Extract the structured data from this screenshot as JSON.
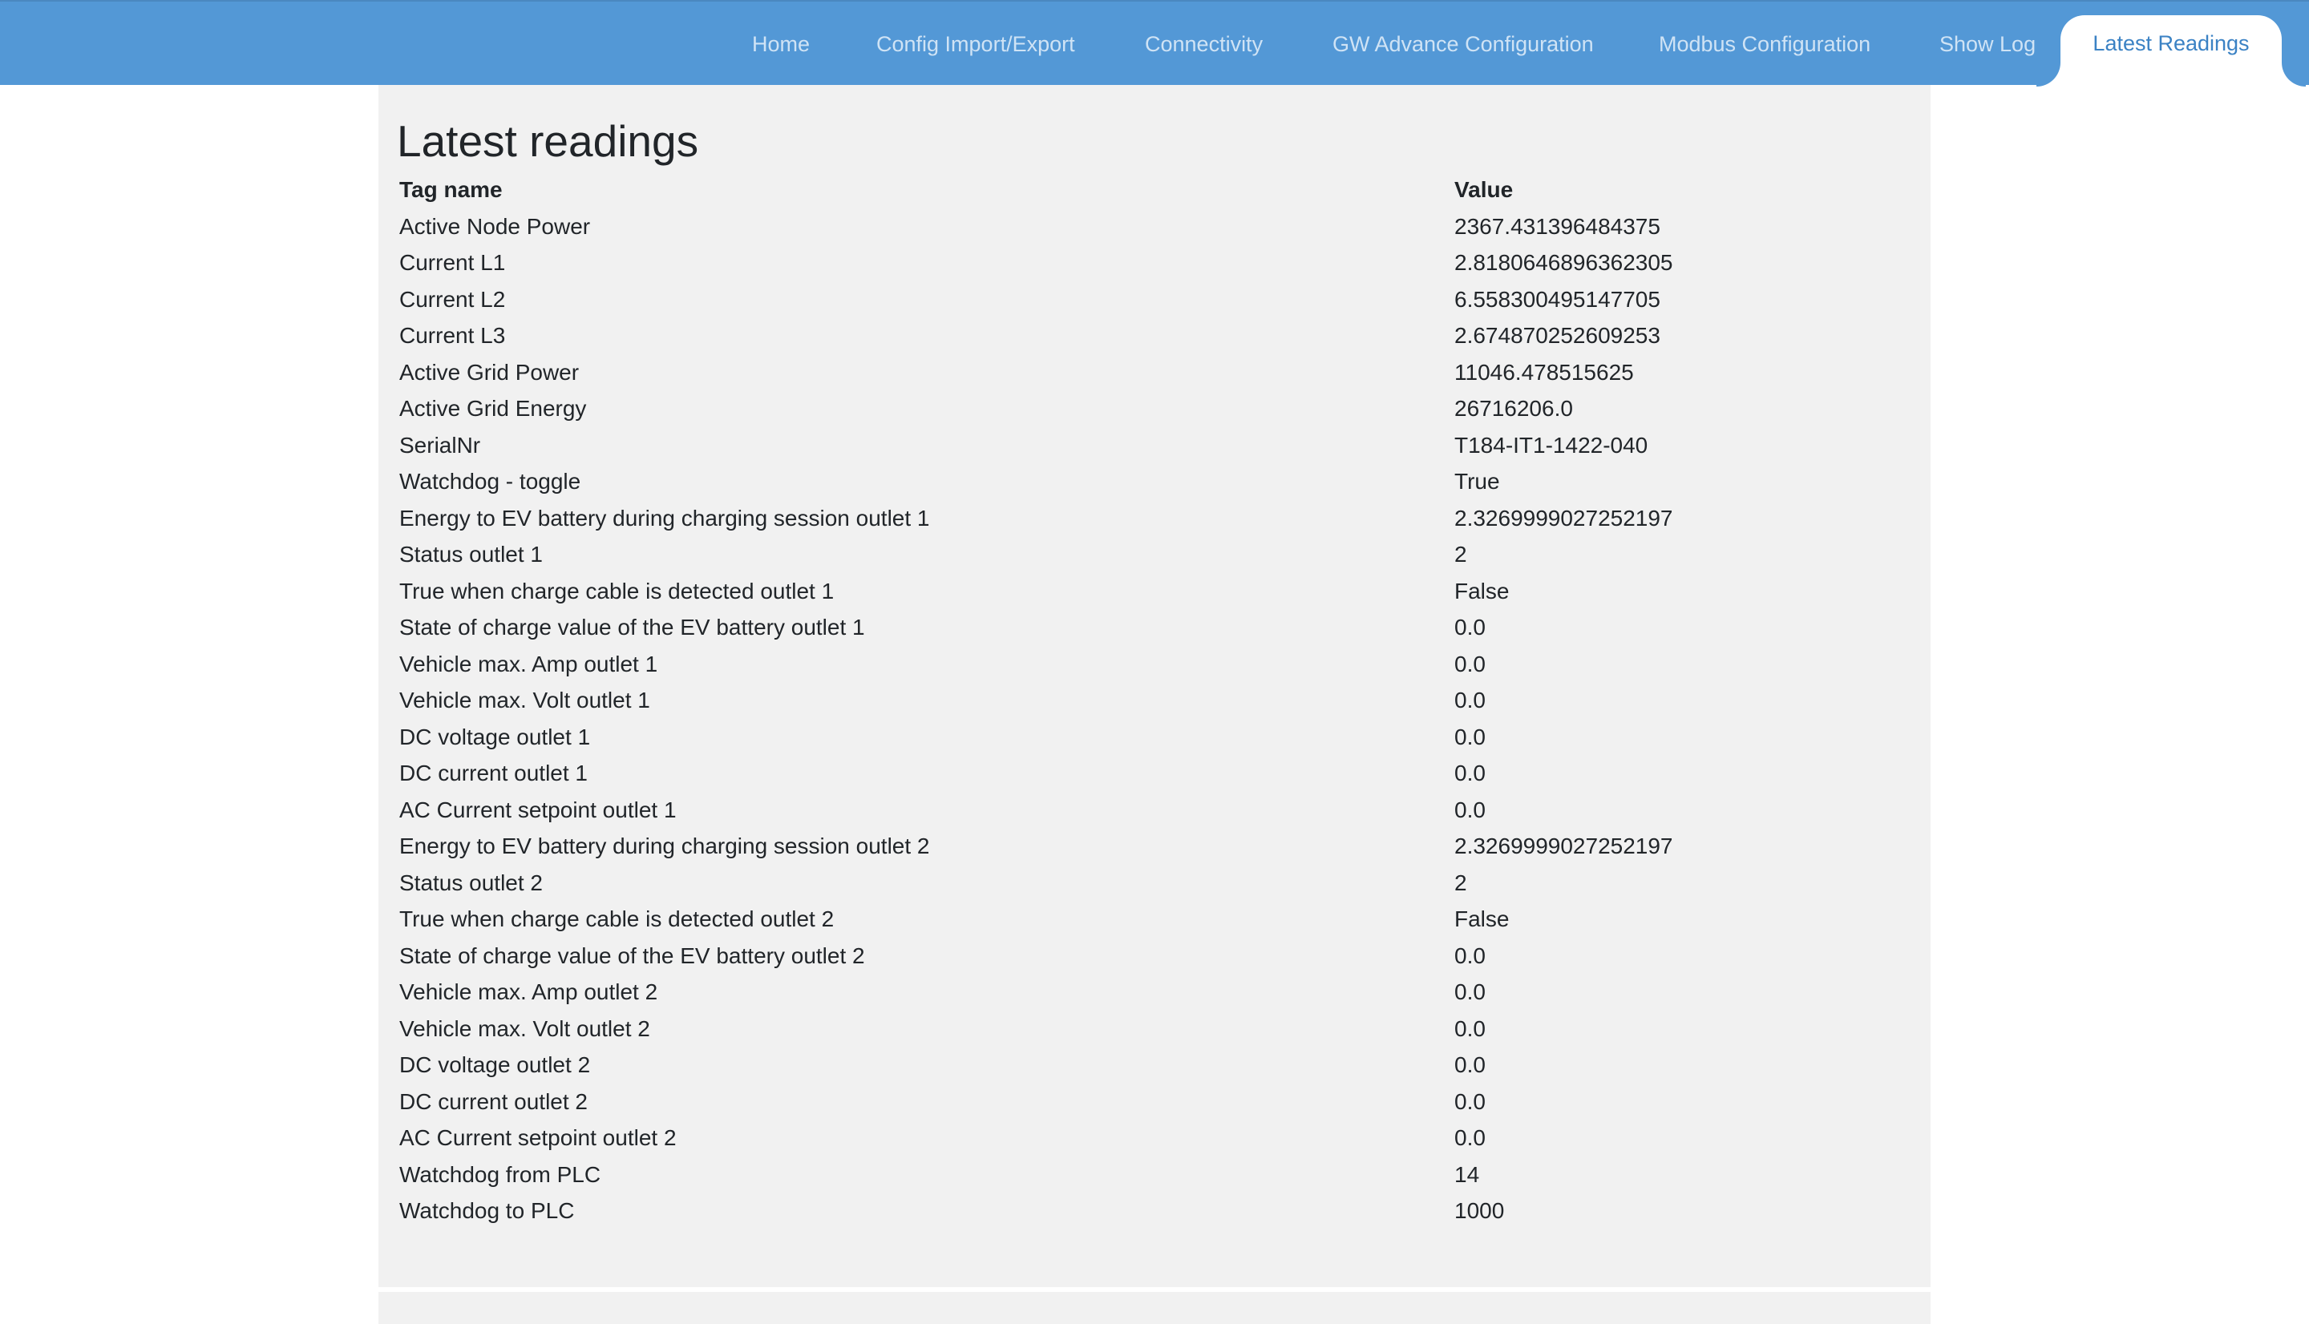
{
  "nav": {
    "items": [
      {
        "label": "Home"
      },
      {
        "label": "Config Import/Export"
      },
      {
        "label": "Connectivity"
      },
      {
        "label": "GW Advance Configuration"
      },
      {
        "label": "Modbus Configuration"
      },
      {
        "label": "Show Log"
      },
      {
        "label": "Latest Readings",
        "active": true
      }
    ]
  },
  "page": {
    "title": "Latest readings"
  },
  "table": {
    "headers": [
      "Tag name",
      "Value"
    ],
    "rows": [
      [
        "Active Node Power",
        "2367.431396484375"
      ],
      [
        "Current L1",
        "2.8180646896362305"
      ],
      [
        "Current L2",
        "6.558300495147705"
      ],
      [
        "Current L3",
        "2.674870252609253"
      ],
      [
        "Active Grid Power",
        "11046.478515625"
      ],
      [
        "Active Grid Energy",
        "26716206.0"
      ],
      [
        "SerialNr",
        "T184-IT1-1422-040"
      ],
      [
        "Watchdog - toggle",
        "True"
      ],
      [
        "Energy to EV battery during charging session outlet 1",
        "2.3269999027252197"
      ],
      [
        "Status outlet 1",
        "2"
      ],
      [
        "True when charge cable is detected outlet 1",
        "False"
      ],
      [
        "State of charge value of the EV battery outlet 1",
        "0.0"
      ],
      [
        "Vehicle max. Amp outlet 1",
        "0.0"
      ],
      [
        "Vehicle max. Volt outlet 1",
        "0.0"
      ],
      [
        "DC voltage outlet 1",
        "0.0"
      ],
      [
        "DC current outlet 1",
        "0.0"
      ],
      [
        "AC Current setpoint outlet 1",
        "0.0"
      ],
      [
        "Energy to EV battery during charging session outlet 2",
        "2.3269999027252197"
      ],
      [
        "Status outlet 2",
        "2"
      ],
      [
        "True when charge cable is detected outlet 2",
        "False"
      ],
      [
        "State of charge value of the EV battery outlet 2",
        "0.0"
      ],
      [
        "Vehicle max. Amp outlet 2",
        "0.0"
      ],
      [
        "Vehicle max. Volt outlet 2",
        "0.0"
      ],
      [
        "DC voltage outlet 2",
        "0.0"
      ],
      [
        "DC current outlet 2",
        "0.0"
      ],
      [
        "AC Current setpoint outlet 2",
        "0.0"
      ],
      [
        "Watchdog from PLC",
        "14"
      ],
      [
        "Watchdog to PLC",
        "1000"
      ]
    ]
  },
  "colors": {
    "topbar": "#5398d6",
    "nav_text": "#cfe3f5",
    "active_tab_text": "#3b82c4",
    "panel_bg": "#f1f1f1"
  }
}
